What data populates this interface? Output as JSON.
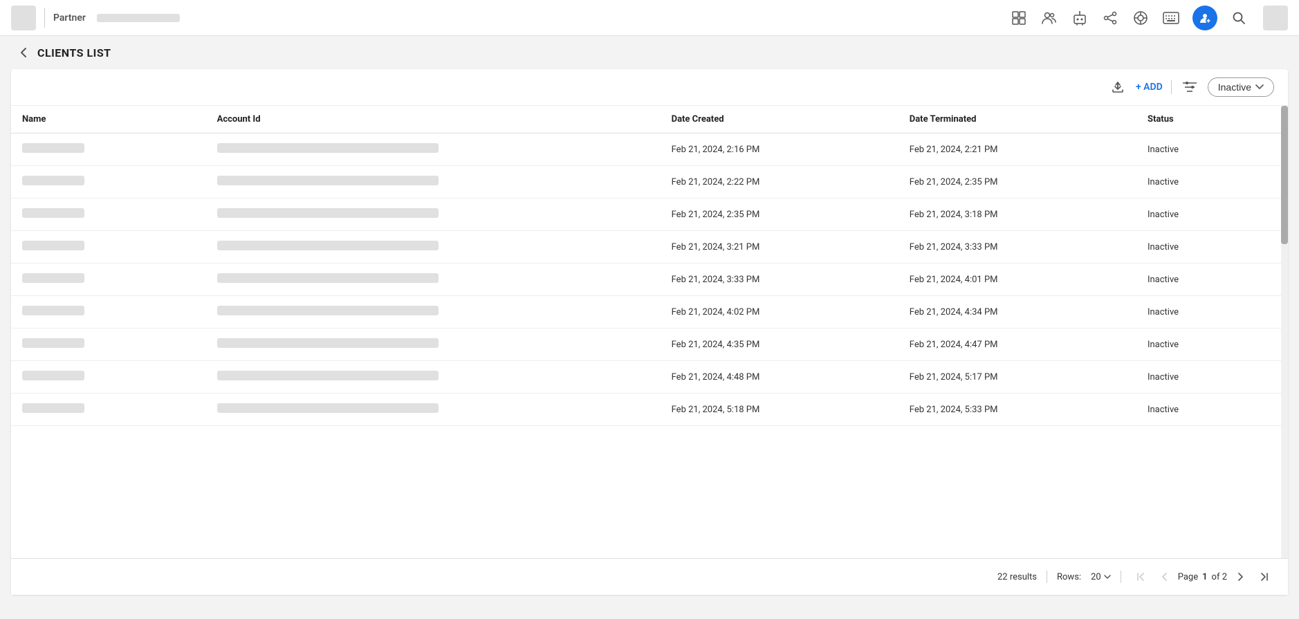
{
  "header": {
    "logo_alt": "App Logo",
    "partner_label": "Partner",
    "back_arrow": "‹",
    "page_title": "CLIENTS LIST"
  },
  "nav_icons": {
    "layout_icon": "⊞",
    "group_icon": "👥",
    "bot_icon": "🤖",
    "share_icon": "⬡",
    "support_icon": "◎",
    "keyboard_icon": "⌨",
    "avatar_icon": "⚙",
    "search_icon": "🔍"
  },
  "toolbar": {
    "export_icon": "↑",
    "add_label": "+ ADD",
    "filter_icon": "≡",
    "status_label": "Inactive",
    "status_chevron": "⌄"
  },
  "table": {
    "columns": [
      {
        "key": "name",
        "label": "Name"
      },
      {
        "key": "accountId",
        "label": "Account Id"
      },
      {
        "key": "dateCreated",
        "label": "Date Created"
      },
      {
        "key": "dateTerminated",
        "label": "Date Terminated"
      },
      {
        "key": "status",
        "label": "Status"
      }
    ],
    "rows": [
      {
        "nameWidth": 90,
        "idWidth": 320,
        "dateCreated": "Feb 21, 2024, 2:16 PM",
        "dateTerminated": "Feb 21, 2024, 2:21 PM",
        "status": "Inactive"
      },
      {
        "nameWidth": 90,
        "idWidth": 320,
        "dateCreated": "Feb 21, 2024, 2:22 PM",
        "dateTerminated": "Feb 21, 2024, 2:35 PM",
        "status": "Inactive"
      },
      {
        "nameWidth": 90,
        "idWidth": 320,
        "dateCreated": "Feb 21, 2024, 2:35 PM",
        "dateTerminated": "Feb 21, 2024, 3:18 PM",
        "status": "Inactive"
      },
      {
        "nameWidth": 90,
        "idWidth": 320,
        "dateCreated": "Feb 21, 2024, 3:21 PM",
        "dateTerminated": "Feb 21, 2024, 3:33 PM",
        "status": "Inactive"
      },
      {
        "nameWidth": 90,
        "idWidth": 320,
        "dateCreated": "Feb 21, 2024, 3:33 PM",
        "dateTerminated": "Feb 21, 2024, 4:01 PM",
        "status": "Inactive"
      },
      {
        "nameWidth": 90,
        "idWidth": 320,
        "dateCreated": "Feb 21, 2024, 4:02 PM",
        "dateTerminated": "Feb 21, 2024, 4:34 PM",
        "status": "Inactive"
      },
      {
        "nameWidth": 90,
        "idWidth": 320,
        "dateCreated": "Feb 21, 2024, 4:35 PM",
        "dateTerminated": "Feb 21, 2024, 4:47 PM",
        "status": "Inactive"
      },
      {
        "nameWidth": 90,
        "idWidth": 320,
        "dateCreated": "Feb 21, 2024, 4:48 PM",
        "dateTerminated": "Feb 21, 2024, 5:17 PM",
        "status": "Inactive"
      },
      {
        "nameWidth": 90,
        "idWidth": 320,
        "dateCreated": "Feb 21, 2024, 5:18 PM",
        "dateTerminated": "Feb 21, 2024, 5:33 PM",
        "status": "Inactive"
      }
    ]
  },
  "footer": {
    "results_count": "22 results",
    "rows_label": "Rows:",
    "rows_value": "20",
    "rows_chevron": "⌄",
    "page_label": "Page",
    "page_current": "1",
    "page_of": "of 2",
    "first_icon": "⟨⟨",
    "prev_icon": "⟨",
    "next_icon": "⟩",
    "last_icon": "⟩⟩"
  }
}
